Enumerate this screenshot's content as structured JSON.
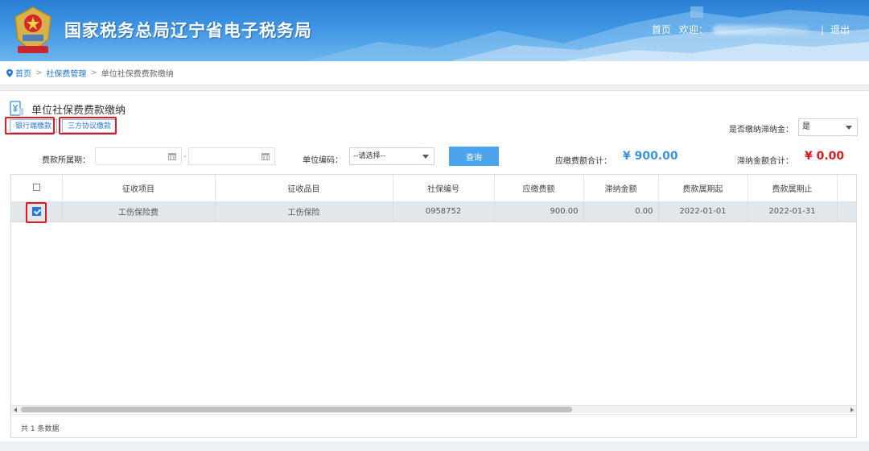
{
  "header": {
    "site_title": "国家税务总局辽宁省电子税务局",
    "nav_home": "首页",
    "welcome": "欢迎：",
    "separator": "|",
    "logout": "退出"
  },
  "breadcrumb": {
    "home": "首页",
    "parent": "社保费管理",
    "current": "单位社保费费款缴纳",
    "sep": ">"
  },
  "page": {
    "title": "单位社保费费款缴纳",
    "tab_bank": "银行端缴款",
    "tab_tripartite": "三方协议缴款"
  },
  "filters": {
    "late_fee_label": "是否缴纳滞纳金：",
    "late_fee_value": "是",
    "period_label": "费款所属期：",
    "date_dash": "-",
    "unit_code_label": "单位编码：",
    "unit_code_value": "--请选择--",
    "query_button": "查询",
    "payable_total_label": "应缴费额合计：",
    "payable_total_value": "¥ 900.00",
    "late_total_label": "滞纳金额合计：",
    "late_total_value": "¥ 0.00"
  },
  "table": {
    "columns": [
      "征收项目",
      "征收品目",
      "社保编号",
      "应缴费额",
      "滞纳金额",
      "费款属期起",
      "费款属期止"
    ],
    "rows": [
      {
        "checked": true,
        "item": "工伤保险费",
        "category": "工伤保险",
        "ss_number": "0958752",
        "payable": "900.00",
        "late_fee": "0.00",
        "period_start": "2022-01-01",
        "period_end": "2022-01-31"
      }
    ],
    "summary": "共 1 条数据"
  },
  "colors": {
    "header_blue": "#2a7fd4",
    "link_blue": "#1e78d8",
    "query_button": "#4ea4ec",
    "amount_blue": "#3a94e0",
    "amount_red": "#e0191d",
    "highlight_red": "#e0191d"
  },
  "icons": {
    "emblem": "tax-emblem-icon",
    "location": "location-pin-icon",
    "page": "yuan-document-icon",
    "calendar": "calendar-icon",
    "dropdown": "chevron-down-icon",
    "checkbox": "checkbox-icon"
  }
}
